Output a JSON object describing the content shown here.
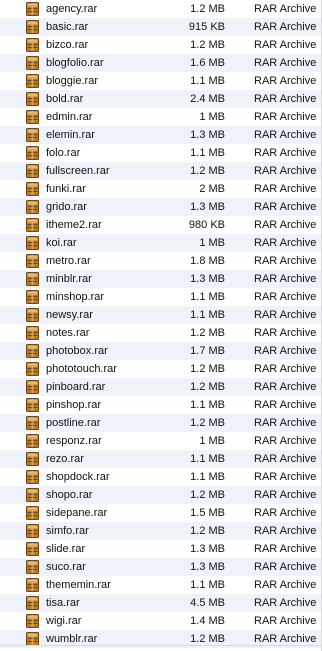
{
  "files": [
    {
      "name": "agency.rar",
      "size": "1.2 MB",
      "kind": "RAR Archive",
      "icon": "rar-archive-icon"
    },
    {
      "name": "basic.rar",
      "size": "915 KB",
      "kind": "RAR Archive",
      "icon": "rar-archive-icon"
    },
    {
      "name": "bizco.rar",
      "size": "1.2 MB",
      "kind": "RAR Archive",
      "icon": "rar-archive-icon"
    },
    {
      "name": "blogfolio.rar",
      "size": "1.6 MB",
      "kind": "RAR Archive",
      "icon": "rar-archive-icon"
    },
    {
      "name": "bloggie.rar",
      "size": "1.1 MB",
      "kind": "RAR Archive",
      "icon": "rar-archive-icon"
    },
    {
      "name": "bold.rar",
      "size": "2.4 MB",
      "kind": "RAR Archive",
      "icon": "rar-archive-icon"
    },
    {
      "name": "edmin.rar",
      "size": "1 MB",
      "kind": "RAR Archive",
      "icon": "rar-archive-icon"
    },
    {
      "name": "elemin.rar",
      "size": "1.3 MB",
      "kind": "RAR Archive",
      "icon": "rar-archive-icon"
    },
    {
      "name": "folo.rar",
      "size": "1.1 MB",
      "kind": "RAR Archive",
      "icon": "rar-archive-icon"
    },
    {
      "name": "fullscreen.rar",
      "size": "1.2 MB",
      "kind": "RAR Archive",
      "icon": "rar-archive-icon"
    },
    {
      "name": "funki.rar",
      "size": "2 MB",
      "kind": "RAR Archive",
      "icon": "rar-archive-icon"
    },
    {
      "name": "grido.rar",
      "size": "1.3 MB",
      "kind": "RAR Archive",
      "icon": "rar-archive-icon"
    },
    {
      "name": "itheme2.rar",
      "size": "980 KB",
      "kind": "RAR Archive",
      "icon": "rar-archive-icon"
    },
    {
      "name": "koi.rar",
      "size": "1 MB",
      "kind": "RAR Archive",
      "icon": "rar-archive-icon"
    },
    {
      "name": "metro.rar",
      "size": "1.8 MB",
      "kind": "RAR Archive",
      "icon": "rar-archive-icon"
    },
    {
      "name": "minblr.rar",
      "size": "1.3 MB",
      "kind": "RAR Archive",
      "icon": "rar-archive-icon"
    },
    {
      "name": "minshop.rar",
      "size": "1.1 MB",
      "kind": "RAR Archive",
      "icon": "rar-archive-icon"
    },
    {
      "name": "newsy.rar",
      "size": "1.1 MB",
      "kind": "RAR Archive",
      "icon": "rar-archive-icon"
    },
    {
      "name": "notes.rar",
      "size": "1.2 MB",
      "kind": "RAR Archive",
      "icon": "rar-archive-icon"
    },
    {
      "name": "photobox.rar",
      "size": "1.7 MB",
      "kind": "RAR Archive",
      "icon": "rar-archive-icon"
    },
    {
      "name": "phototouch.rar",
      "size": "1.2 MB",
      "kind": "RAR Archive",
      "icon": "rar-archive-icon"
    },
    {
      "name": "pinboard.rar",
      "size": "1.2 MB",
      "kind": "RAR Archive",
      "icon": "rar-archive-icon"
    },
    {
      "name": "pinshop.rar",
      "size": "1.1 MB",
      "kind": "RAR Archive",
      "icon": "rar-archive-icon"
    },
    {
      "name": "postline.rar",
      "size": "1.2 MB",
      "kind": "RAR Archive",
      "icon": "rar-archive-icon"
    },
    {
      "name": "responz.rar",
      "size": "1 MB",
      "kind": "RAR Archive",
      "icon": "rar-archive-icon"
    },
    {
      "name": "rezo.rar",
      "size": "1.1 MB",
      "kind": "RAR Archive",
      "icon": "rar-archive-icon"
    },
    {
      "name": "shopdock.rar",
      "size": "1.1 MB",
      "kind": "RAR Archive",
      "icon": "rar-archive-icon"
    },
    {
      "name": "shopo.rar",
      "size": "1.2 MB",
      "kind": "RAR Archive",
      "icon": "rar-archive-icon"
    },
    {
      "name": "sidepane.rar",
      "size": "1.5 MB",
      "kind": "RAR Archive",
      "icon": "rar-archive-icon"
    },
    {
      "name": "simfo.rar",
      "size": "1.2 MB",
      "kind": "RAR Archive",
      "icon": "rar-archive-icon"
    },
    {
      "name": "slide.rar",
      "size": "1.3 MB",
      "kind": "RAR Archive",
      "icon": "rar-archive-icon"
    },
    {
      "name": "suco.rar",
      "size": "1.3 MB",
      "kind": "RAR Archive",
      "icon": "rar-archive-icon"
    },
    {
      "name": "thememin.rar",
      "size": "1.1 MB",
      "kind": "RAR Archive",
      "icon": "rar-archive-icon"
    },
    {
      "name": "tisa.rar",
      "size": "4.5 MB",
      "kind": "RAR Archive",
      "icon": "rar-archive-icon"
    },
    {
      "name": "wigi.rar",
      "size": "1.4 MB",
      "kind": "RAR Archive",
      "icon": "rar-archive-icon"
    },
    {
      "name": "wumblr.rar",
      "size": "1.2 MB",
      "kind": "RAR Archive",
      "icon": "rar-archive-icon"
    }
  ],
  "colors": {
    "row_alternate": "#eef3fa",
    "icon_body": "#b87a2c",
    "icon_light": "#e8b866",
    "icon_dark": "#6e4313"
  }
}
